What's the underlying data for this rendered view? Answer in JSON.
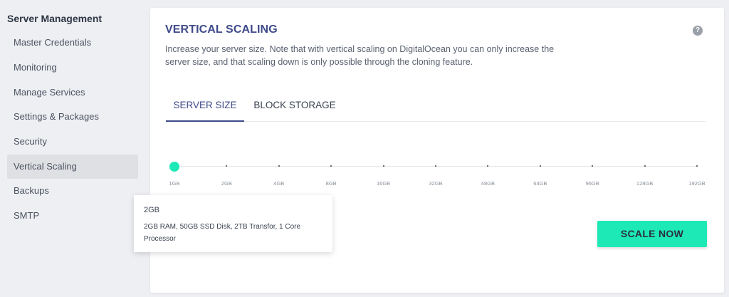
{
  "sidebar": {
    "title": "Server Management",
    "items": [
      {
        "label": "Master Credentials"
      },
      {
        "label": "Monitoring"
      },
      {
        "label": "Manage Services"
      },
      {
        "label": "Settings & Packages"
      },
      {
        "label": "Security"
      },
      {
        "label": "Vertical Scaling",
        "active": true
      },
      {
        "label": "Backups"
      },
      {
        "label": "SMTP"
      }
    ]
  },
  "main": {
    "title": "VERTICAL SCALING",
    "help_icon": "question-circle-icon",
    "help_glyph": "?",
    "description": "Increase your server size. Note that with vertical scaling on DigitalOcean you can only increase the server size, and that scaling down is only possible through the cloning feature.",
    "tabs": [
      {
        "label": "SERVER SIZE",
        "active": true
      },
      {
        "label": "BLOCK STORAGE",
        "active": false
      }
    ],
    "slider": {
      "options": [
        "1GB",
        "2GB",
        "4GB",
        "8GB",
        "16GB",
        "32GB",
        "48GB",
        "64GB",
        "96GB",
        "128GB",
        "192GB"
      ],
      "selected_index": 0
    },
    "tooltip": {
      "title": "2GB",
      "details": "2GB RAM, 50GB SSD Disk, 2TB Transfor, 1 Core Processor"
    },
    "scale_button": "SCALE NOW"
  },
  "colors": {
    "accent": "#1de9b6",
    "title": "#3f4a8a",
    "background": "#eeeff2"
  }
}
